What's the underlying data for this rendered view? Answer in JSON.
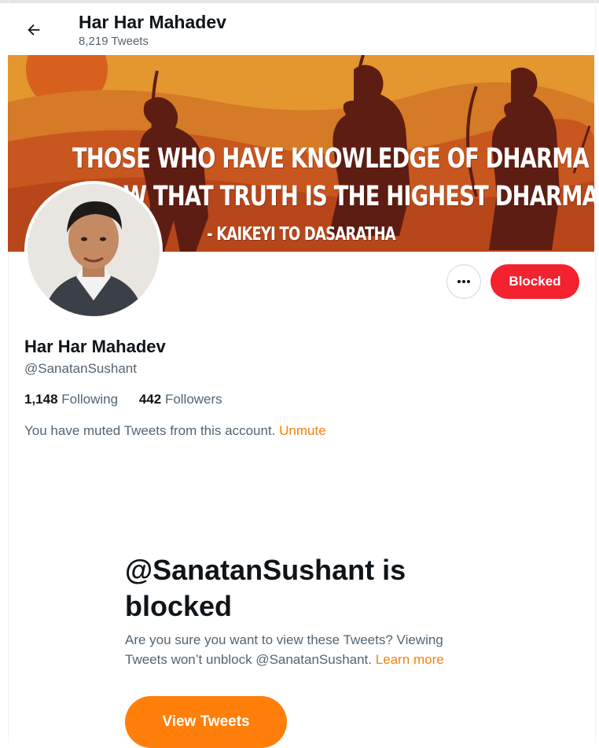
{
  "header": {
    "back_icon": "arrow-left-icon",
    "title": "Har Har Mahadev",
    "tweet_count": "8,219 Tweets"
  },
  "banner": {
    "line1": "THOSE WHO HAVE KNOWLEDGE OF DHARMA",
    "line2": "KNOW THAT TRUTH IS THE HIGHEST DHARMA.",
    "line3": "- KAIKEYI TO DASARATHA",
    "colors": {
      "sky": "#e08a2c",
      "hills": "#c8561f",
      "silhouette": "#5e1d12"
    }
  },
  "profile": {
    "name": "Har Har Mahadev",
    "handle": "@SanatanSushant",
    "following_count": "1,148",
    "following_label": "Following",
    "followers_count": "442",
    "followers_label": "Followers",
    "muted_text": "You have muted Tweets from this account.",
    "unmute_label": "Unmute"
  },
  "actions": {
    "more_icon": "more-horizontal-icon",
    "blocked_label": "Blocked",
    "blocked_color": "#f4212e"
  },
  "blocked_notice": {
    "title": "@SanatanSushant is blocked",
    "description": "Are you sure you want to view these Tweets? Viewing Tweets won’t unblock @SanatanSushant.",
    "learn_more": "Learn more",
    "view_button": "View Tweets",
    "accent_color": "#ff7f0a"
  }
}
